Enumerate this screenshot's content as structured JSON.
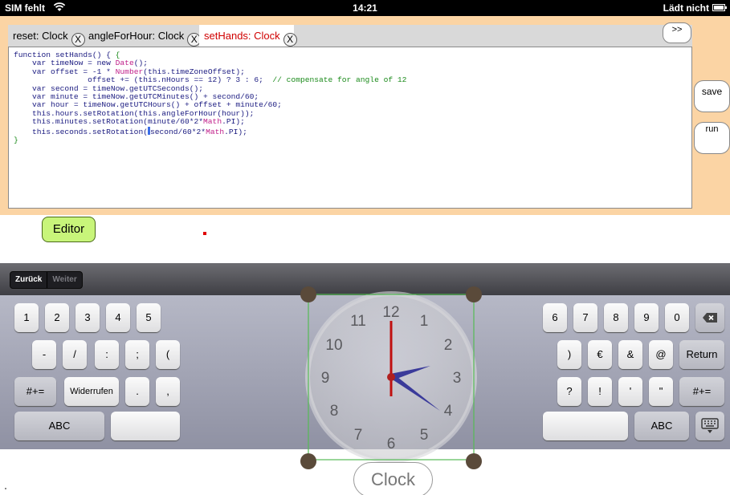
{
  "status": {
    "carrier": "SIM fehlt",
    "time": "14:21",
    "battery_text": "Lädt nicht"
  },
  "tabs": [
    {
      "label": "reset: Clock",
      "close": "X"
    },
    {
      "label": "angleForHour: Clock",
      "close": "X"
    },
    {
      "label": "setHands: Clock",
      "close": "X"
    }
  ],
  "toolbar": {
    "more_label": ">>",
    "save_label": "save",
    "run_label": "run"
  },
  "code": {
    "l1": "function setHands() {",
    "l2a": "    var timeNow = new ",
    "l2b": "Date",
    "l2c": "();",
    "l3a": "    var offset = -1 * ",
    "l3b": "Number",
    "l3c": "(this.timeZoneOffset);",
    "l4a": "                offset += (this.nHours == 12) ? 3 : 6;  ",
    "l4b": "// compensate for angle of 12",
    "l5": "    var second = timeNow.getUTCSeconds();",
    "l6": "    var minute = timeNow.getUTCMinutes() + second/60;",
    "l7": "    var hour = timeNow.getUTCHours() + offset + minute/60;",
    "l8": "    this.hours.setRotation(this.angleForHour(hour));",
    "l9a": "    this.minutes.setRotation(minute/60*2*",
    "l9b": "Math",
    "l9c": ".PI);",
    "l10a": "    this.seconds.setRotation(",
    "l10b": "second/60*2*",
    "l10c": "Math",
    "l10d": ".PI);",
    "l11": "}"
  },
  "editor_label": "Editor",
  "keyboard": {
    "back": "Zurück",
    "forward": "Weiter",
    "row1_left": [
      "1",
      "2",
      "3",
      "4",
      "5"
    ],
    "row1_right": [
      "6",
      "7",
      "8",
      "9",
      "0"
    ],
    "delete_icon": "backspace-icon",
    "row2_left": [
      "-",
      "/",
      ":",
      ";",
      "("
    ],
    "row2_right": [
      ")",
      "€",
      "&",
      "@"
    ],
    "return": "Return",
    "row3_left_more": "#+=",
    "undo": "Widerrufen",
    "row3_left": [
      ".",
      ","
    ],
    "row3_right": [
      "?",
      "!",
      "'",
      "\""
    ],
    "row3_right_more": "#+=",
    "abc_left": "ABC",
    "abc_right": "ABC",
    "hide_icon": "keyboard-hide-icon"
  },
  "clock": {
    "label": "Clock",
    "numbers": [
      "12",
      "1",
      "2",
      "3",
      "4",
      "5",
      "6",
      "7",
      "8",
      "9",
      "10",
      "11"
    ],
    "hour_hand_color": "#3a3a9a",
    "minute_hand_color": "#3a3a9a",
    "second_hand_color": "#c01010",
    "selection_color": "#55bb55"
  }
}
